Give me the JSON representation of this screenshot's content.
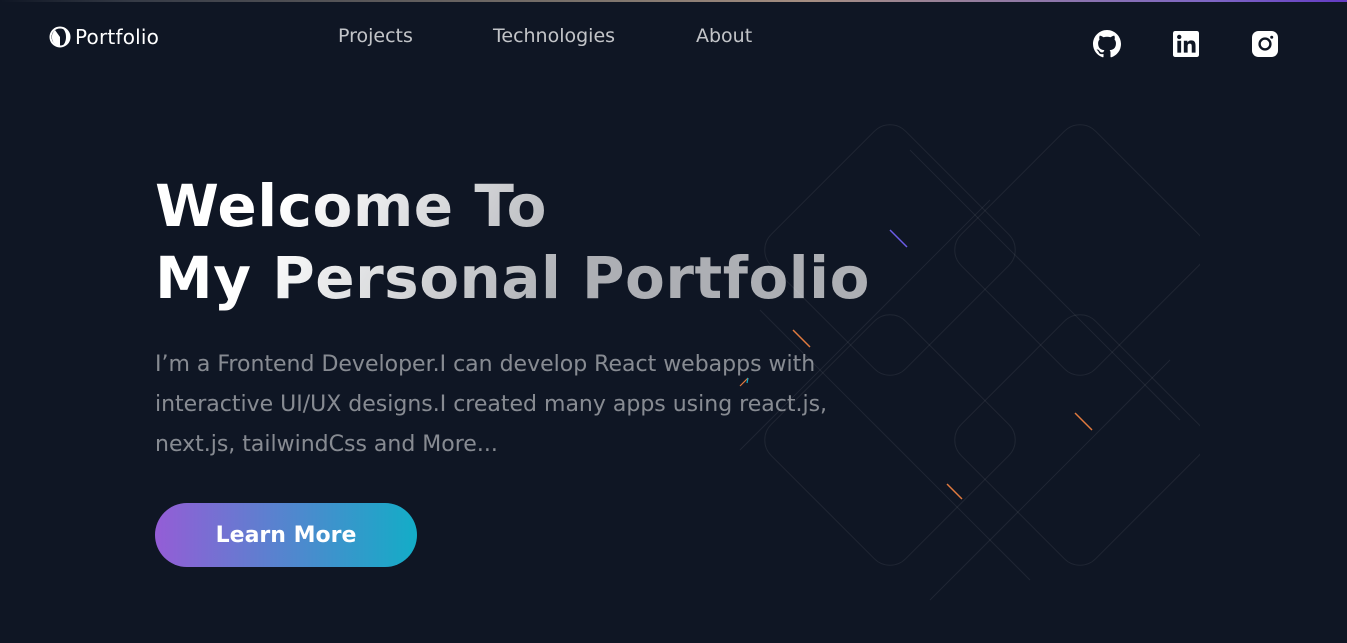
{
  "header": {
    "logo_text": "Portfolio",
    "logo_icon": "half-circle-logo-icon",
    "nav": {
      "projects": "Projects",
      "technologies": "Technologies",
      "about": "About"
    },
    "socials": [
      "github-icon",
      "linkedin-icon",
      "instagram-icon"
    ]
  },
  "hero": {
    "title_line1": "Welcome To",
    "title_line2": "My Personal Portfolio",
    "description": "I’m a Frontend Developer.I can develop React webapps with interactive UI/UX designs.I created many apps using react.js, next.js, tailwindCss and More...",
    "button_label": "Learn More"
  },
  "colors": {
    "background": "#0f1624",
    "button_gradient_start": "#945dd6",
    "button_gradient_mid": "#6978d1",
    "button_gradient_end": "#13adc7",
    "text_primary": "#ffffff",
    "text_muted": "rgba(255,255,255,0.5)"
  }
}
